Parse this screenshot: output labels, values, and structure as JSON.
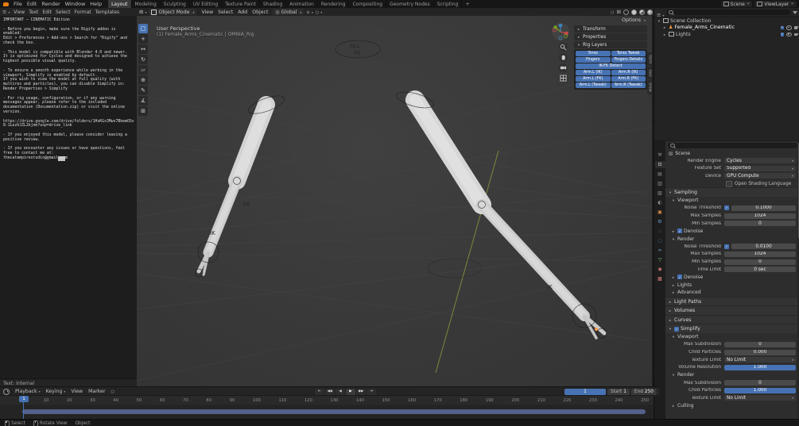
{
  "colors": {
    "accent": "#4772b3",
    "object_orange": "#e9973c",
    "mesh_gray": "#d6d6d6",
    "axis_green": "#7a8c3c"
  },
  "topbar": {
    "menus": [
      "File",
      "Edit",
      "Render",
      "Window",
      "Help"
    ],
    "workspaces": [
      {
        "label": "Layout",
        "mods": "active"
      },
      {
        "label": "Modeling"
      },
      {
        "label": "Sculpting"
      },
      {
        "label": "UV Editing"
      },
      {
        "label": "Texture Paint"
      },
      {
        "label": "Shading"
      },
      {
        "label": "Animation"
      },
      {
        "label": "Rendering"
      },
      {
        "label": "Compositing"
      },
      {
        "label": "Geometry Nodes"
      },
      {
        "label": "Scripting"
      }
    ],
    "add_workspace": "+",
    "scene_name": "Scene",
    "view_layer_name": "ViewLayer"
  },
  "text_editor": {
    "menus": [
      "View",
      "Text",
      "Edit",
      "Select",
      "Format",
      "Templates"
    ],
    "lines": [
      "IMPORTANT – CINEMATIC Edition",
      "",
      "- Before you begin, make sure the Rigify addon is",
      "enabled:",
      "Edit > Preferences > Add-ons > Search for \"Rigify\" and",
      "check the box.",
      "",
      "- This model is compatible with Blender 4.0 and newer.",
      "It is optimized for Cycles and designed to achieve the",
      "highest possible visual quality.",
      "",
      "- To ensure a smooth experience while working in the",
      "viewport, Simplify is enabled by default.",
      "If you wish to view the model at full quality (with",
      "multires and particles), you can disable Simplify in:",
      "Render Properties > Simplify",
      "",
      "- For rig usage, configuration, or if any warning",
      "messages appear, please refer to the included",
      "documentation (Documentation.zip) or visit the online",
      "version.",
      "",
      "https://drive.google.com/drive/folders/1HvKGs3Mws7BkemOSv",
      "8-1LezhJZL2kjnm?usp=drive_link",
      "",
      "- If you enjoyed this model, please consider leaving a",
      "positive review.",
      "",
      "- If you encounter any issues or have questions, feel",
      "free to contact me at:",
      "thecatempirestudio@gmail.com"
    ],
    "footer": "Text: Internal"
  },
  "viewport": {
    "mode": "Object Mode",
    "menus": [
      "View",
      "Select",
      "Add",
      "Object"
    ],
    "orientation": "Global",
    "options_label": "Options",
    "view_label": "User Perspective",
    "scene_label": "(1) Female_Arms_Cinematic | OMNIA_Rig",
    "toolbar": [
      {
        "name": "select-box",
        "glyph": "▢",
        "mods": "active"
      },
      {
        "name": "cursor",
        "glyph": "+"
      },
      {
        "name": "move",
        "glyph": "↔"
      },
      {
        "name": "rotate",
        "glyph": "↻"
      },
      {
        "name": "scale",
        "glyph": "▱"
      },
      {
        "name": "transform",
        "glyph": "⊕"
      },
      {
        "name": "annotate",
        "glyph": "✎"
      },
      {
        "name": "measure",
        "glyph": "∡"
      },
      {
        "name": "add-primitive",
        "glyph": "⊞"
      }
    ],
    "rig_layers": {
      "panels": [
        "Transform",
        "Properties",
        "Rig Layers"
      ],
      "buttons": [
        {
          "label": "Torso"
        },
        {
          "label": "Torso Tweak"
        },
        {
          "label": "Fingers"
        },
        {
          "label": "Fingers Details"
        },
        {
          "label": "IK-FK Detect",
          "mods": "wide"
        },
        {
          "label": "Arm.L (IK)"
        },
        {
          "label": "Arm.R (IK)"
        },
        {
          "label": "Arm.L (FK)"
        },
        {
          "label": "Arm.R (FK)"
        },
        {
          "label": "Arm.L (Tweak)"
        },
        {
          "label": "Arm.R (Tweak)"
        }
      ],
      "side_tabs": [
        "Item",
        "Tool",
        "View"
      ]
    },
    "scene_labels": {
      "all": "ALL",
      "fk": "FK",
      "ik": "IK"
    }
  },
  "outliner": {
    "scene_collection": "Scene Collection",
    "armature_object": "Female_Arms_Cinematic",
    "lights_collection": "Lights"
  },
  "properties": {
    "breadcrumb": "Scene",
    "tabs": [
      {
        "name": "tool",
        "glyph": "⚒"
      },
      {
        "name": "render",
        "glyph": "⊡",
        "mods": "active"
      },
      {
        "name": "output",
        "glyph": "▤"
      },
      {
        "name": "view-layer",
        "glyph": "▥"
      },
      {
        "name": "scene",
        "glyph": "▧"
      },
      {
        "name": "world",
        "glyph": "◐"
      },
      {
        "name": "object",
        "glyph": "▣",
        "mods": "c-orange"
      },
      {
        "name": "modifiers",
        "glyph": "⚙",
        "mods": "c-blue"
      },
      {
        "name": "particles",
        "glyph": "∴",
        "mods": "c-blue"
      },
      {
        "name": "physics",
        "glyph": "◌",
        "mods": "c-blue"
      },
      {
        "name": "constraints",
        "glyph": "∞",
        "mods": "c-blue"
      },
      {
        "name": "object-data",
        "glyph": "▽",
        "mods": "c-green"
      },
      {
        "name": "material",
        "glyph": "◉",
        "mods": "c-red"
      },
      {
        "name": "texture",
        "glyph": "▩",
        "mods": "c-red"
      }
    ],
    "top_rows": [
      {
        "label": "Render Engine",
        "value": "Cycles",
        "mods": "dropdown"
      },
      {
        "label": "Feature Set",
        "value": "Supported",
        "mods": "dropdown"
      },
      {
        "label": "Device",
        "value": "GPU Compute",
        "mods": "dropdown"
      }
    ],
    "osl_label": "Open Shading Language",
    "sections": {
      "sampling": "Sampling",
      "viewport": "Viewport",
      "render": "Render",
      "denoise": "Denoise",
      "lights": "Lights",
      "advanced": "Advanced",
      "light_paths": "Light Paths",
      "volumes": "Volumes",
      "curves": "Curves",
      "simplify": "Simplify",
      "culling": "Culling"
    },
    "sampling_viewport_rows": [
      {
        "label": "Noise Threshold",
        "value": "0.1000",
        "mods": "checked"
      },
      {
        "label": "Max Samples",
        "value": "1024"
      },
      {
        "label": "Min Samples",
        "value": "0"
      }
    ],
    "sampling_render_rows": [
      {
        "label": "Noise Threshold",
        "value": "0.0100",
        "mods": "checked"
      },
      {
        "label": "Max Samples",
        "value": "1024"
      },
      {
        "label": "Min Samples",
        "value": "0"
      },
      {
        "label": "Time Limit",
        "value": "0 sec"
      }
    ],
    "simplify_viewport_rows": [
      {
        "label": "Max Subdivision",
        "value": "0"
      },
      {
        "label": "Child Particles",
        "value": "0.000"
      },
      {
        "label": "Texture Limit",
        "value": "No Limit",
        "mods": "dropdown"
      },
      {
        "label": "Volume Resolution",
        "value": "1.000",
        "mods": "blue"
      }
    ],
    "simplify_render_rows": [
      {
        "label": "Max Subdivision",
        "value": "0"
      },
      {
        "label": "Child Particles",
        "value": "1.000",
        "mods": "blue"
      },
      {
        "label": "Texture Limit",
        "value": "No Limit",
        "mods": "dropdown"
      }
    ]
  },
  "timeline": {
    "menus": [
      {
        "label": "Playback",
        "mods": "dd"
      },
      {
        "label": "Keying",
        "mods": "dd"
      },
      {
        "label": "View"
      },
      {
        "label": "Marker"
      }
    ],
    "playback": [
      {
        "name": "jump-to-start",
        "glyph": "⇤"
      },
      {
        "name": "jump-to-prev-keyframe",
        "glyph": "◀◆"
      },
      {
        "name": "play-reverse",
        "glyph": "◀"
      },
      {
        "name": "play",
        "glyph": "▶",
        "mods": "play"
      },
      {
        "name": "jump-to-next-keyframe",
        "glyph": "◆▶"
      },
      {
        "name": "jump-to-end",
        "glyph": "⇥"
      }
    ],
    "current_frame": "1",
    "start_label": "Start",
    "start_value": "1",
    "end_label": "End",
    "end_value": "250",
    "ruler": [
      "1",
      "10",
      "20",
      "30",
      "40",
      "50",
      "60",
      "70",
      "80",
      "90",
      "100",
      "110",
      "120",
      "130",
      "140",
      "150",
      "160",
      "170",
      "180",
      "190",
      "200",
      "210",
      "220",
      "230",
      "240",
      "250"
    ]
  },
  "statusbar": {
    "items": [
      {
        "label": "Select",
        "mods": "lmb"
      },
      {
        "label": "Rotate View",
        "mods": "mmb"
      },
      {
        "label": "Object",
        "mods": "plain"
      }
    ]
  }
}
